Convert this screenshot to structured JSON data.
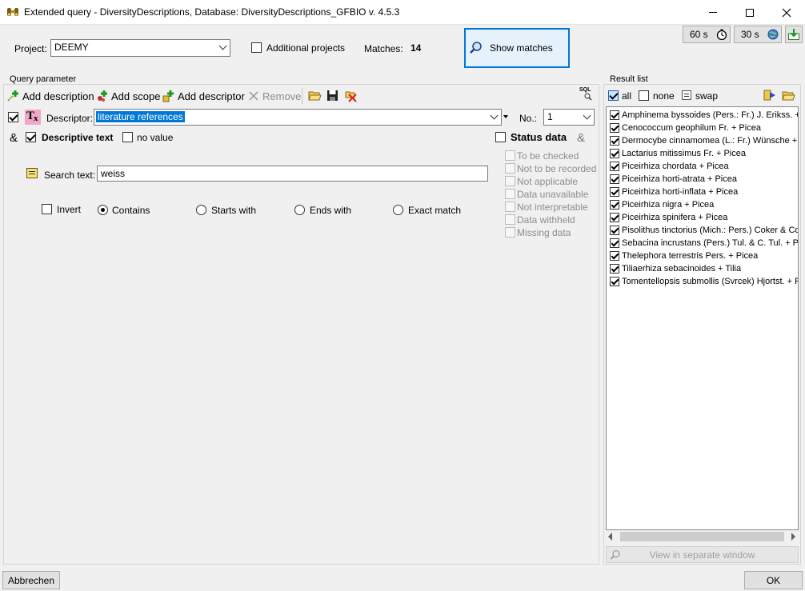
{
  "window": {
    "title": "Extended query - DiversityDescriptions,  Database: DiversityDescriptions_GFBIO     v. 4.5.3"
  },
  "header": {
    "project_label": "Project:",
    "project_value": "DEEMY",
    "additional_projects_label": "Additional projects",
    "matches_label": "Matches:",
    "matches_value": "14",
    "show_matches_label": "Show matches",
    "timer_60_label": "60 s",
    "timer_30_label": "30 s"
  },
  "query": {
    "group_label": "Query parameter",
    "toolbar": {
      "add_description": "Add description",
      "add_scope": "Add scope",
      "add_descriptor": "Add descriptor",
      "remove": "Remove",
      "sql_label": "SQL"
    },
    "descriptor_label": "Descriptor:",
    "descriptor_value": "literature references",
    "no_label": "No.:",
    "no_value": "1",
    "amp": "&",
    "descriptive_text_label": "Descriptive text",
    "no_value_label": "no value",
    "status_data_label": "Status data",
    "status_items": [
      "To be checked",
      "Not to be recorded",
      "Not applicable",
      "Data unavailable",
      "Not interpretable",
      "Data withheld",
      "Missing data"
    ],
    "search_text_label": "Search text:",
    "search_text_value": "weiss",
    "invert_label": "Invert",
    "match_modes": [
      "Contains",
      "Starts with",
      "Ends with",
      "Exact match"
    ]
  },
  "results": {
    "group_label": "Result list",
    "all_label": "all",
    "none_label": "none",
    "swap_label": "swap",
    "items": [
      "Amphinema byssoides (Pers.: Fr.) J. Erikss. + Pi",
      "Cenococcum geophilum Fr. + Picea",
      "Dermocybe cinnamomea (L.: Fr.) Wünsche + P",
      "Lactarius mitissimus Fr. + Picea",
      "Piceirhiza chordata + Picea",
      "Piceirhiza horti-atrata + Picea",
      "Piceirhiza horti-inflata + Picea",
      "Piceirhiza nigra + Picea",
      "Piceirhiza spinifera + Picea",
      "Pisolithus tinctorius (Mich.: Pers.) Coker & Couc",
      "Sebacina incrustans (Pers.) Tul. & C. Tul. + Pic",
      "Thelephora terrestris Pers. + Picea",
      "Tiliaerhiza sebacinoides + Tilia",
      "Tomentellopsis submollis (Svrcek) Hjortst. + Pic"
    ],
    "view_separate_label": "View in separate window"
  },
  "footer": {
    "cancel_label": "Abbrechen",
    "ok_label": "OK"
  }
}
